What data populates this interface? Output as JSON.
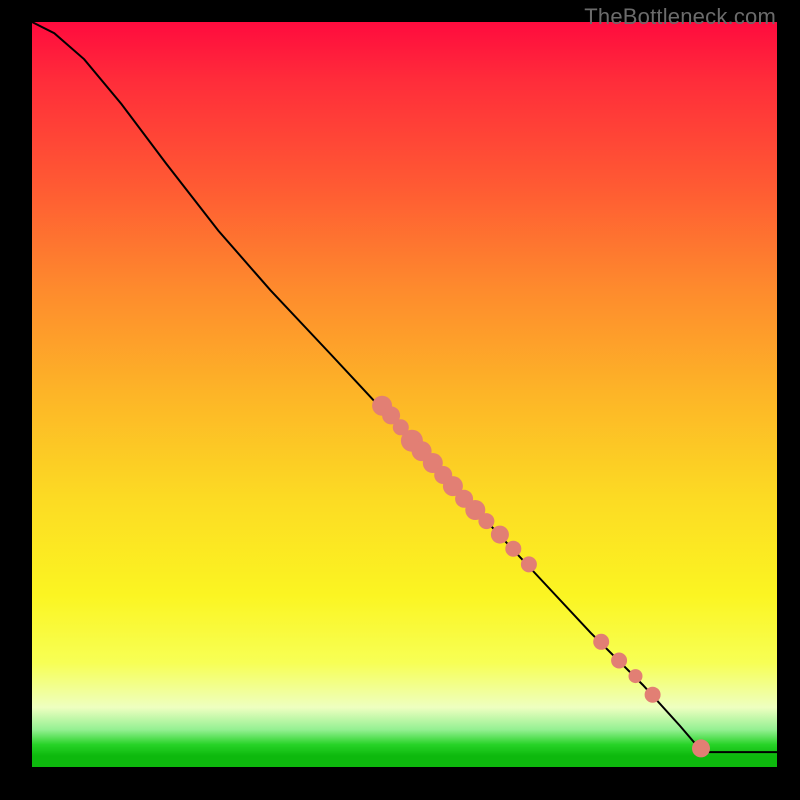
{
  "watermark": "TheBottleneck.com",
  "colors": {
    "point_fill": "#e27f74",
    "curve_stroke": "#000000",
    "frame": "#000000"
  },
  "chart_data": {
    "type": "line",
    "title": "",
    "xlabel": "",
    "ylabel": "",
    "xlim": [
      0,
      1
    ],
    "ylim": [
      0,
      1
    ],
    "notes": "Axes are unlabeled; gradient background from red (top) through orange/yellow to a thin green band at the bottom. Curve is monotonically decreasing from top-left, bends near top, nearly linear through midsection, flattens to y≈0.02 from x≈0.90 to x=1.",
    "curve": [
      {
        "x": 0.0,
        "y": 1.0
      },
      {
        "x": 0.03,
        "y": 0.985
      },
      {
        "x": 0.07,
        "y": 0.95
      },
      {
        "x": 0.12,
        "y": 0.89
      },
      {
        "x": 0.18,
        "y": 0.81
      },
      {
        "x": 0.25,
        "y": 0.72
      },
      {
        "x": 0.32,
        "y": 0.64
      },
      {
        "x": 0.4,
        "y": 0.555
      },
      {
        "x": 0.47,
        "y": 0.48
      },
      {
        "x": 0.54,
        "y": 0.405
      },
      {
        "x": 0.61,
        "y": 0.33
      },
      {
        "x": 0.68,
        "y": 0.255
      },
      {
        "x": 0.75,
        "y": 0.18
      },
      {
        "x": 0.82,
        "y": 0.11
      },
      {
        "x": 0.87,
        "y": 0.055
      },
      {
        "x": 0.9,
        "y": 0.02
      },
      {
        "x": 1.0,
        "y": 0.02
      }
    ],
    "points": [
      {
        "x": 0.47,
        "y": 0.485,
        "r": 10
      },
      {
        "x": 0.482,
        "y": 0.472,
        "r": 9
      },
      {
        "x": 0.495,
        "y": 0.456,
        "r": 8
      },
      {
        "x": 0.51,
        "y": 0.438,
        "r": 11
      },
      {
        "x": 0.523,
        "y": 0.424,
        "r": 10
      },
      {
        "x": 0.538,
        "y": 0.408,
        "r": 10
      },
      {
        "x": 0.552,
        "y": 0.392,
        "r": 9
      },
      {
        "x": 0.565,
        "y": 0.377,
        "r": 10
      },
      {
        "x": 0.58,
        "y": 0.36,
        "r": 9
      },
      {
        "x": 0.595,
        "y": 0.345,
        "r": 10
      },
      {
        "x": 0.61,
        "y": 0.33,
        "r": 8
      },
      {
        "x": 0.628,
        "y": 0.312,
        "r": 9
      },
      {
        "x": 0.646,
        "y": 0.293,
        "r": 8
      },
      {
        "x": 0.667,
        "y": 0.272,
        "r": 8
      },
      {
        "x": 0.764,
        "y": 0.168,
        "r": 8
      },
      {
        "x": 0.788,
        "y": 0.143,
        "r": 8
      },
      {
        "x": 0.81,
        "y": 0.122,
        "r": 7
      },
      {
        "x": 0.833,
        "y": 0.097,
        "r": 8
      },
      {
        "x": 0.898,
        "y": 0.025,
        "r": 9
      }
    ]
  }
}
